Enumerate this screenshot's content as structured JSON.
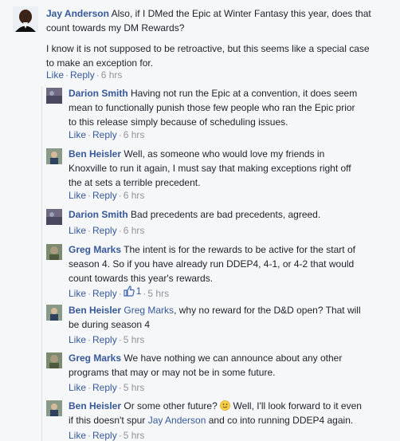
{
  "top_comment": {
    "author": "Jay Anderson",
    "text_line1": "Also, if I DMed the Epic at Winter Fantasy this year, does that",
    "text_line2": "count towards my DM Rewards?",
    "text_para2_line1": "I know it is not supposed to be retroactive, but this seems like a special case",
    "text_para2_line2": "to make an exception for.",
    "like_label": "Like",
    "reply_label": "Reply",
    "time": "6 hrs"
  },
  "replies": [
    {
      "author": "Darion Smith",
      "lines": [
        "Having not run the Epic at a convention, it does seem",
        "mean to functionally punish those few people who ran the Epic prior",
        "to this release simply because of scheduling issues."
      ],
      "like_label": "Like",
      "reply_label": "Reply",
      "time": "6 hrs"
    },
    {
      "author": "Ben Heisler",
      "lines": [
        "Well, as someone who would love my friends in",
        "Knoxville to run it again, I must say that making exceptions right off",
        "the at sets a terrible precedent."
      ],
      "like_label": "Like",
      "reply_label": "Reply",
      "time": "6 hrs"
    },
    {
      "author": "Darion Smith",
      "lines": [
        "Bad precedents are bad precedents, agreed."
      ],
      "like_label": "Like",
      "reply_label": "Reply",
      "time": "6 hrs"
    },
    {
      "author": "Greg Marks",
      "lines": [
        "The intent is for the rewards to be active for the start of",
        "season 4. So if you have already run DDEP4, 4-1, or 4-2 that would",
        "count towards this year's rewards."
      ],
      "like_label": "Like",
      "reply_label": "Reply",
      "like_count": "1",
      "time": "5 hrs"
    },
    {
      "author": "Ben Heisler",
      "mention": "Greg Marks",
      "lines": [
        ", why no reward for the D&D open? That will",
        "be during season 4"
      ],
      "like_label": "Like",
      "reply_label": "Reply",
      "time": "5 hrs"
    },
    {
      "author": "Greg Marks",
      "lines": [
        "We have nothing we can announce about any other",
        "programs that may or may not be in some future."
      ],
      "like_label": "Like",
      "reply_label": "Reply",
      "time": "5 hrs"
    },
    {
      "author": "Ben Heisler",
      "line1_a": "Or some other future?",
      "line1_b": "Well, I'll look forward to it even",
      "line2_a": "if this doesn't spur",
      "mention": "Jay Anderson",
      "line2_b": "and co into running DDEP4 again.",
      "like_label": "Like",
      "reply_label": "Reply",
      "time": "5 hrs"
    }
  ],
  "colors": {
    "link": "#365899",
    "meta": "#90949c",
    "text": "#1d2129"
  }
}
